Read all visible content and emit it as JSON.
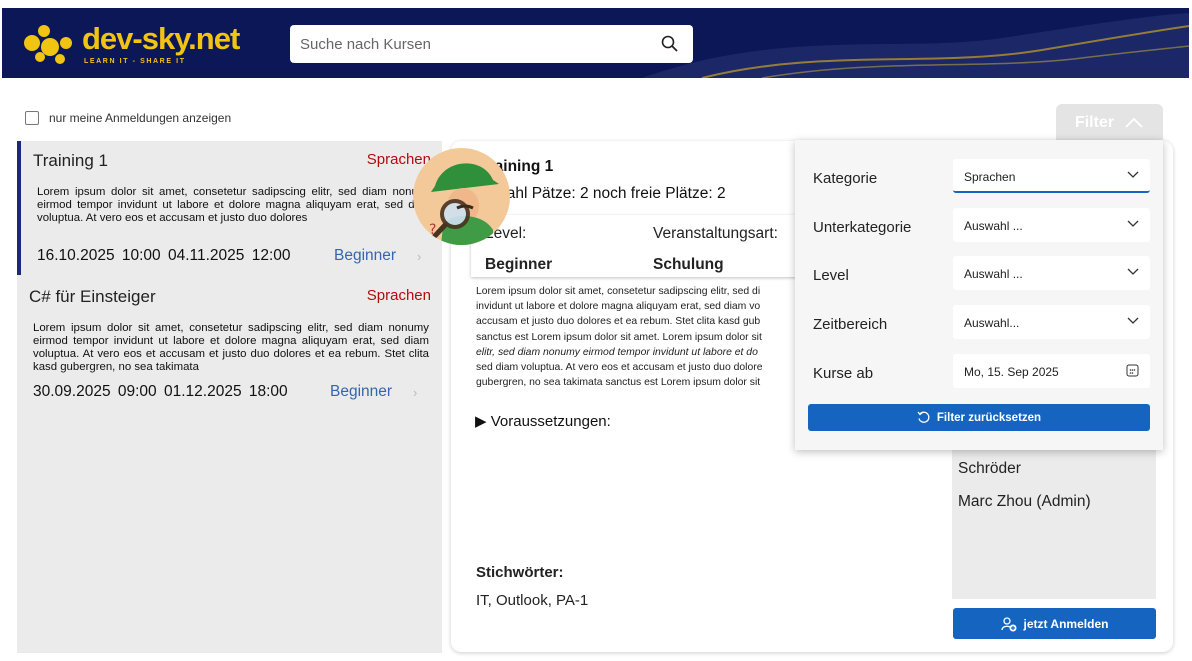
{
  "header": {
    "logo_text": "dev-sky.net",
    "logo_tagline": "LEARN IT - SHARE IT",
    "search_placeholder": "Suche nach Kursen",
    "icons": {
      "search": "search-icon"
    }
  },
  "toolbar": {
    "only_my_registrations_label": "nur meine Anmeldungen anzeigen",
    "only_my_registrations_checked": false,
    "filter_label": "Filter"
  },
  "courses": [
    {
      "title": "Training 1",
      "category": "Sprachen",
      "description": "Lorem ipsum dolor sit amet, consetetur sadipscing elitr, sed diam nonumy eirmod tempor invidunt ut labore et dolore magna aliquyam erat, sed diam voluptua. At vero eos et accusam et justo duo dolores",
      "start": "16.10.2025 10:00",
      "end": "04.11.2025 12:00",
      "level": "Beginner",
      "selected": true
    },
    {
      "title": "C# für Einsteiger",
      "category": "Sprachen",
      "description": "Lorem ipsum dolor sit amet, consetetur sadipscing elitr, sed diam nonumy eirmod tempor invidunt ut labore et dolore magna aliquyam erat, sed diam voluptua. At vero eos et accusam et justo duo dolores et ea rebum. Stet clita kasd gubergren, no sea takimata",
      "start": "30.09.2025 09:00",
      "end": "01.12.2025 18:00",
      "level": "Beginner",
      "selected": false
    }
  ],
  "detail": {
    "title": "Training 1",
    "spots": "Anzahl Pätze: 2 noch freie Plätze: 2",
    "level_label": "Level:",
    "level_value": "Beginner",
    "event_type_label": "Veranstaltungsart:",
    "event_type_value": "Schulung",
    "description_lines": [
      "Lorem ipsum dolor sit amet, consetetur sadipscing elitr, sed di",
      "invidunt ut labore et dolore magna aliquyam erat, sed diam vo",
      "accusam et justo duo dolores et ea rebum. Stet clita kasd gub",
      "sanctus est Lorem ipsum dolor sit amet. Lorem ipsum dolor sit",
      "elitr, sed diam nonumy eirmod tempor invidunt ut labore et do",
      "sed diam voluptua. At vero eos et accusam et justo duo dolore",
      "gubergren, no sea takimata sanctus est Lorem ipsum dolor sit"
    ],
    "prerequisites_label": "Voraussetzungen:",
    "keywords_label": "Stichwörter:",
    "keywords_value": "IT, Outlook, PA-1",
    "people": [
      "Schröder",
      "Marc Zhou (Admin)"
    ],
    "register_label": "jetzt Anmelden"
  },
  "filter_panel": {
    "rows": [
      {
        "label": "Kategorie",
        "value": "Sprachen",
        "icon": "chevron-down-icon"
      },
      {
        "label": "Unterkategorie",
        "value": "Auswahl ...",
        "icon": "chevron-down-icon"
      },
      {
        "label": "Level",
        "value": "Auswahl ...",
        "icon": "chevron-down-icon"
      },
      {
        "label": "Zeitbereich",
        "value": "Auswahl...",
        "icon": "chevron-down-icon"
      },
      {
        "label": "Kurse ab",
        "value": "Mo, 15. Sep 2025",
        "icon": "calendar-icon"
      }
    ],
    "reset_label": "Filter zurücksetzen"
  },
  "colors": {
    "header_bg": "#0b1757",
    "brand_yellow": "#f2c412",
    "accent_blue": "#1565c0",
    "category_red": "#b10d0d",
    "level_blue": "#3465b0"
  }
}
